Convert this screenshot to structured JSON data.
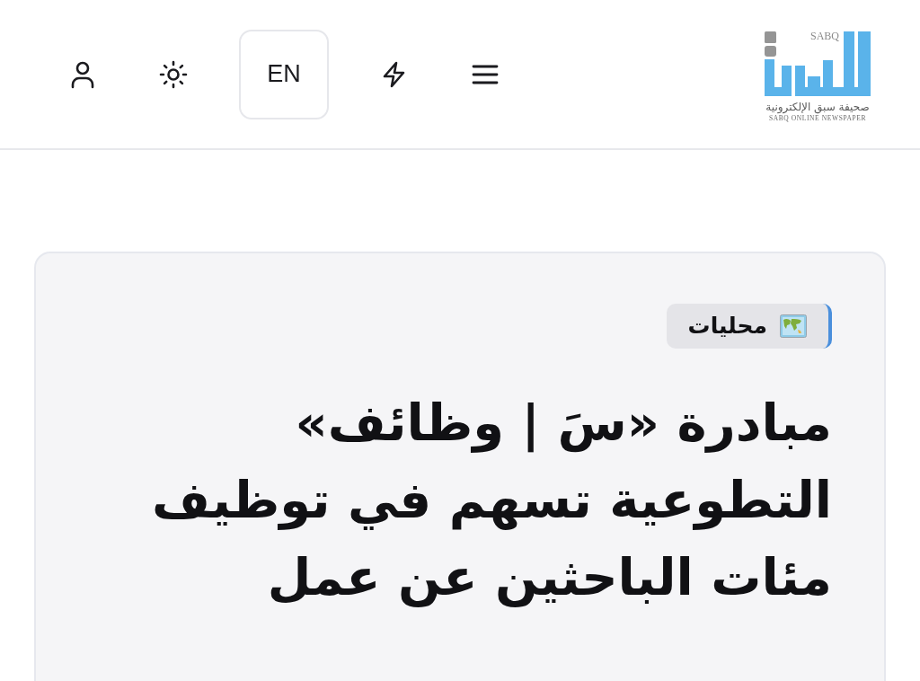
{
  "header": {
    "logo": {
      "wordmark": "SABQ",
      "arabic_name": "صحيفة سبق الإلكترونية",
      "english_name": "SABQ ONLINE NEWSPAPER"
    },
    "actions": [
      {
        "kind": "menu"
      },
      {
        "kind": "flash"
      },
      {
        "kind": "language",
        "label": "EN"
      },
      {
        "kind": "theme"
      },
      {
        "kind": "account"
      }
    ]
  },
  "article": {
    "category": {
      "label": "محليات"
    },
    "headline": "مبادرة «سَ | وظائف» التطوعية تسهم في توظيف مئات الباحثين عن عمل"
  }
}
